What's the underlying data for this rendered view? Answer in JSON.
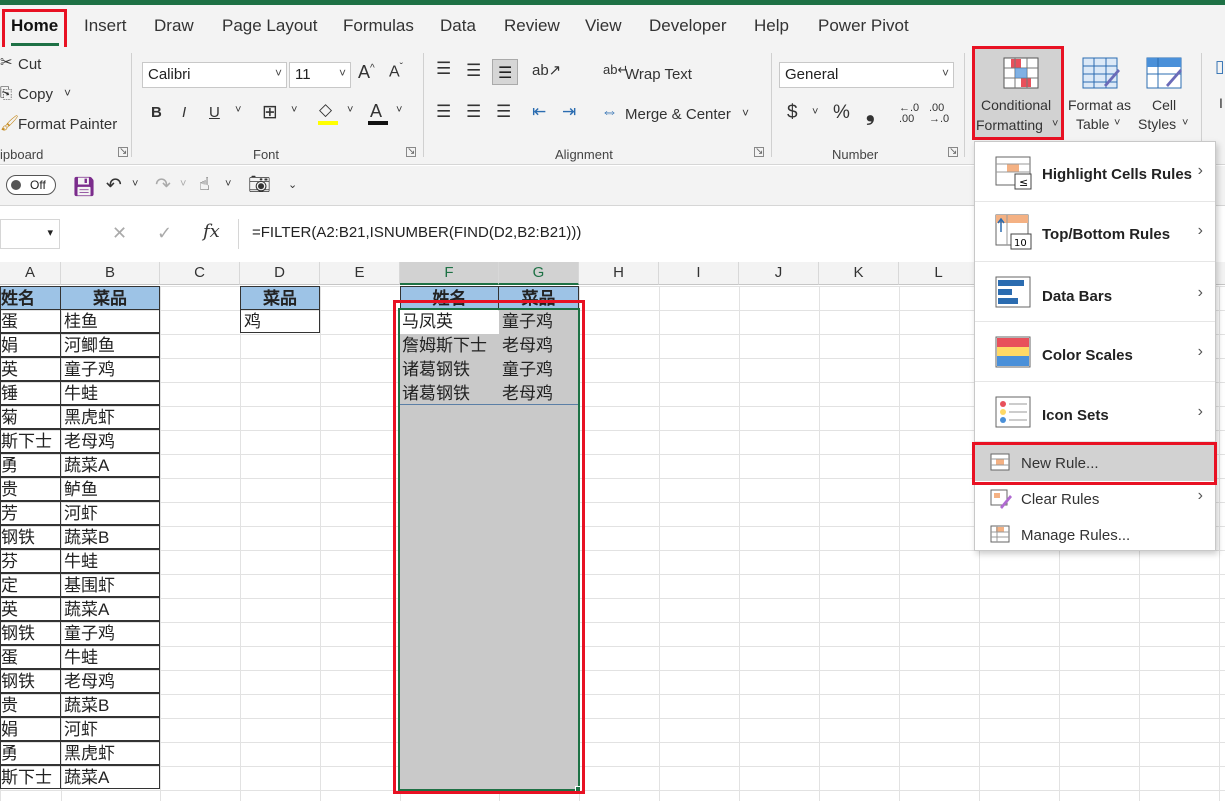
{
  "tabs": [
    "Home",
    "Insert",
    "Draw",
    "Page Layout",
    "Formulas",
    "Data",
    "Review",
    "View",
    "Developer",
    "Help",
    "Power Pivot"
  ],
  "clipboard": {
    "cut": "Cut",
    "copy": "Copy",
    "format_painter": "Format Painter",
    "group": "ipboard"
  },
  "font": {
    "name": "Calibri",
    "size": "11",
    "group": "Font",
    "grow": "A^",
    "shrink": "A˅",
    "bold": "B",
    "italic": "I",
    "underline": "U",
    "font_color": "A"
  },
  "alignment": {
    "wrap_text": "Wrap Text",
    "merge_center": "Merge & Center",
    "group": "Alignment"
  },
  "number": {
    "format": "General",
    "group": "Number",
    "currency": "$",
    "percent": "%",
    "comma": "❟",
    "inc_decimal": "←.0 .00",
    "dec_decimal": ".00 →.0"
  },
  "styles": {
    "conditional_line1": "Conditional",
    "conditional_line2": "Formatting",
    "format_table_line1": "Format as",
    "format_table_line2": "Table",
    "cell_styles_line1": "Cell",
    "cell_styles_line2": "Styles"
  },
  "qat": {
    "autosave": "Off"
  },
  "formula_bar": {
    "formula": "=FILTER(A2:B21,ISNUMBER(FIND(D2,B2:B21)))",
    "fx": "fx"
  },
  "columns": [
    "A",
    "B",
    "C",
    "D",
    "E",
    "F",
    "G",
    "H",
    "I",
    "J",
    "K",
    "L"
  ],
  "sheet": {
    "a_header": "姓名",
    "b_header": "菜品",
    "rows": [
      [
        "蛋",
        "桂鱼"
      ],
      [
        "娟",
        "河鲫鱼"
      ],
      [
        "英",
        "童子鸡"
      ],
      [
        "锤",
        "牛蛙"
      ],
      [
        "菊",
        "黑虎虾"
      ],
      [
        "斯下士",
        "老母鸡"
      ],
      [
        "勇",
        "蔬菜A"
      ],
      [
        "贵",
        "鲈鱼"
      ],
      [
        "芳",
        "河虾"
      ],
      [
        "钢铁",
        "蔬菜B"
      ],
      [
        "芬",
        "牛蛙"
      ],
      [
        "定",
        "基围虾"
      ],
      [
        "英",
        "蔬菜A"
      ],
      [
        "钢铁",
        "童子鸡"
      ],
      [
        "蛋",
        "牛蛙"
      ],
      [
        "钢铁",
        "老母鸡"
      ],
      [
        "贵",
        "蔬菜B"
      ],
      [
        "娟",
        "河虾"
      ],
      [
        "勇",
        "黑虎虾"
      ],
      [
        "斯下士",
        "蔬菜A"
      ]
    ],
    "d_header": "菜品",
    "d_value": "鸡",
    "f_header": "姓名",
    "g_header": "菜品",
    "results": [
      [
        "马凤英",
        "童子鸡"
      ],
      [
        "詹姆斯下士",
        "老母鸡"
      ],
      [
        "诸葛钢铁",
        "童子鸡"
      ],
      [
        "诸葛钢铁",
        "老母鸡"
      ]
    ]
  },
  "menu": {
    "highlight": "Highlight Cells Rules",
    "topbottom": "Top/Bottom Rules",
    "databars": "Data Bars",
    "colorscales": "Color Scales",
    "iconsets": "Icon Sets",
    "newrule": "New Rule...",
    "clearrules": "Clear Rules",
    "managerules": "Manage Rules..."
  },
  "colors": {
    "accent": "#1e7145",
    "highlight_box": "#e81123",
    "header_fill": "#9dc3e6",
    "selection_fill": "#c9c9c9"
  }
}
